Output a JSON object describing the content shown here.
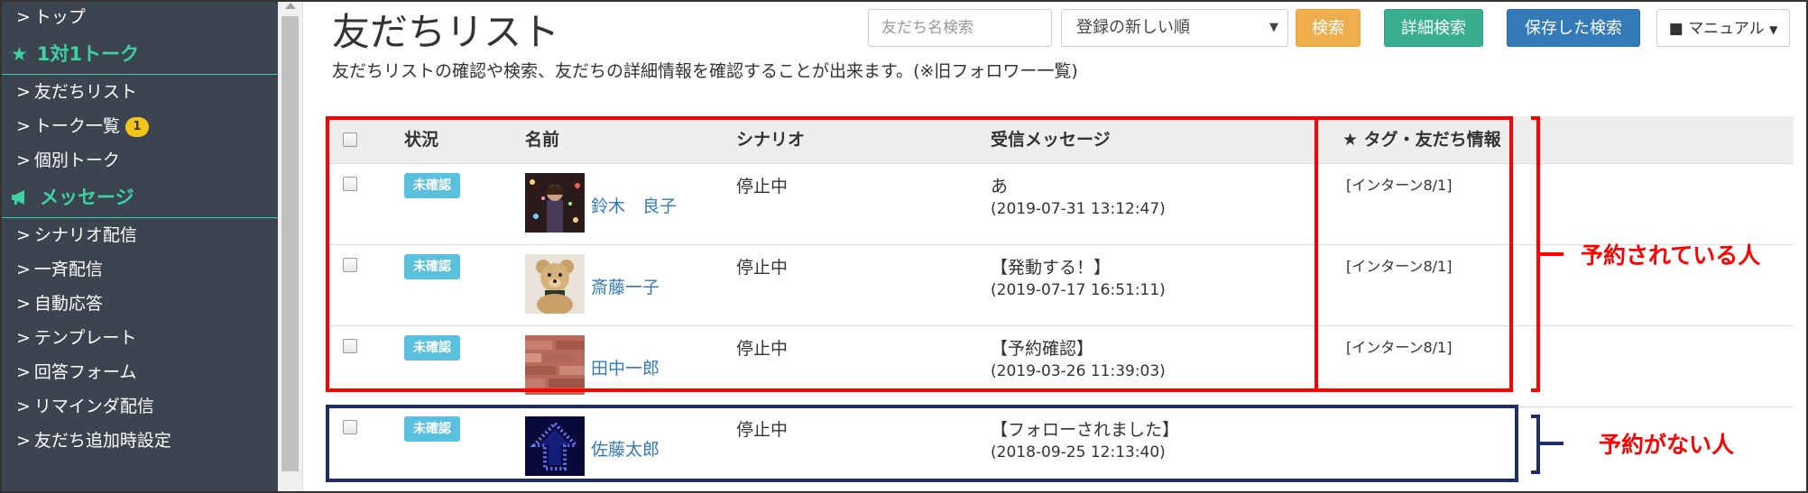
{
  "sidebar": {
    "items": [
      {
        "label": "トップ",
        "type": "link"
      },
      {
        "label": "1対1トーク",
        "type": "section",
        "icon": "star-icon"
      },
      {
        "label": "友だちリスト",
        "type": "link"
      },
      {
        "label": "トーク一覧",
        "type": "link",
        "badge": "1"
      },
      {
        "label": "個別トーク",
        "type": "link"
      },
      {
        "label": "メッセージ",
        "type": "section",
        "icon": "megaphone-icon"
      },
      {
        "label": "シナリオ配信",
        "type": "link"
      },
      {
        "label": "一斉配信",
        "type": "link"
      },
      {
        "label": "自動応答",
        "type": "link"
      },
      {
        "label": "テンプレート",
        "type": "link"
      },
      {
        "label": "回答フォーム",
        "type": "link"
      },
      {
        "label": "リマインダ配信",
        "type": "link"
      },
      {
        "label": "友だち追加時設定",
        "type": "link"
      }
    ]
  },
  "header": {
    "title": "友だちリスト",
    "description": "友だちリストの確認や検索、友だちの詳細情報を確認することが出来ます。(※旧フォロワー一覧)",
    "search_placeholder": "友だち名検索",
    "sort_value": "登録の新しい順",
    "search_button": "検索",
    "detail_search_button": "詳細検索",
    "saved_search_button": "保存した検索",
    "manual_button": "マニュアル"
  },
  "table": {
    "columns": {
      "status": "状況",
      "name": "名前",
      "scenario": "シナリオ",
      "message": "受信メッセージ",
      "tags": "★ タグ・友だち情報"
    },
    "rows": [
      {
        "status": "未確認",
        "name": "鈴木　良子",
        "scenario": "停止中",
        "message": "あ",
        "time": "(2019-07-31 13:12:47)",
        "tag": "[インターン8/1]",
        "avatar": "person-photo"
      },
      {
        "status": "未確認",
        "name": "斎藤一子",
        "scenario": "停止中",
        "message": "【発動する！】",
        "time": "(2019-07-17 16:51:11)",
        "tag": "[インターン8/1]",
        "avatar": "teddy-bear-photo"
      },
      {
        "status": "未確認",
        "name": "田中一郎",
        "scenario": "停止中",
        "message": "【予約確認】",
        "time": "(2019-03-26 11:39:03)",
        "tag": "[インターン8/1]",
        "avatar": "brick-wall-photo"
      },
      {
        "status": "未確認",
        "name": "佐藤太郎",
        "scenario": "停止中",
        "message": "【フォローされました】",
        "time": "(2018-09-25 12:13:40)",
        "tag": "",
        "avatar": "blue-arrow-light-photo"
      }
    ]
  },
  "annotations": {
    "reserved_label": "予約されている人",
    "not_reserved_label": "予約がない人",
    "reserved_color": "#ff0000",
    "not_reserved_color": "#1f2d6b"
  },
  "colors": {
    "sidebar_bg": "#3c4450",
    "sidebar_accent": "#3dd1a3",
    "badge_unread": "#5bc0de",
    "btn_search": "#f0ad4e",
    "btn_detail": "#3aaf8f",
    "btn_saved": "#337ab7"
  }
}
